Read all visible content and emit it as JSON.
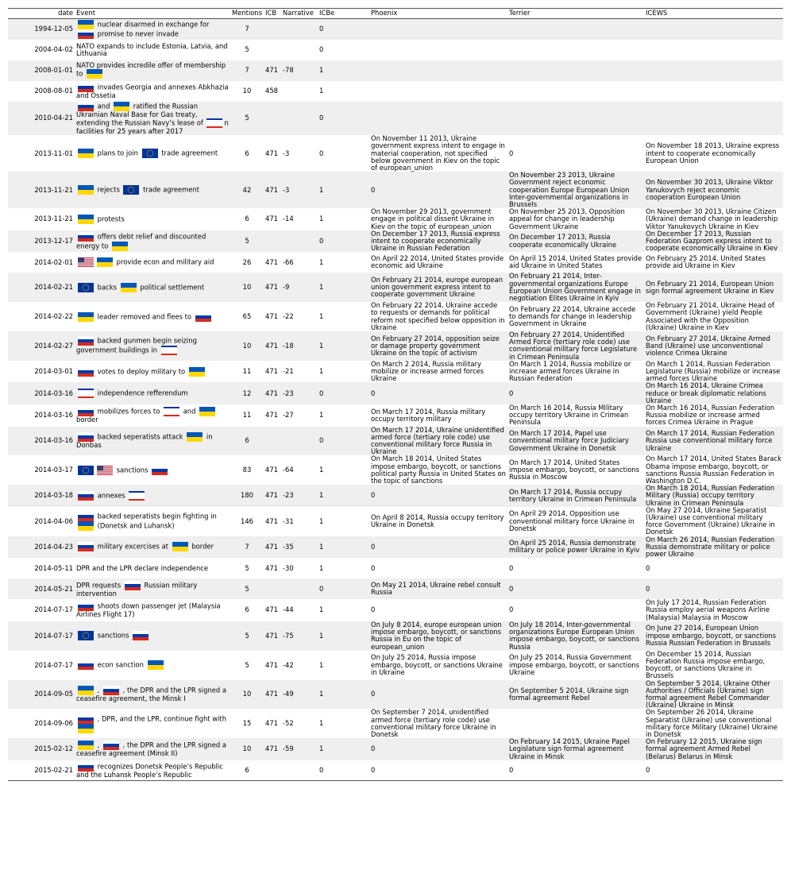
{
  "headers": {
    "date": "date",
    "event": "Event",
    "mentions": "Mentions",
    "icb": "ICB",
    "narrative": "Narrative",
    "icbe": "ICBe",
    "phoenix": "Phoenix",
    "terrier": "Terrier",
    "icews": "ICEWS"
  },
  "flags": {
    "ua": {
      "top": "#0057b7",
      "bottom": "#ffd700"
    },
    "ru": {
      "top": "#ffffff",
      "mid": "#0039a6",
      "bottom": "#d52b1e"
    },
    "eu": {
      "bg": "#003399",
      "stars": "#ffcc00"
    },
    "us": {
      "stripe": "#b22234",
      "canton": "#3c3b6e"
    },
    "crimea": {
      "top": "#0033a0",
      "mid": "#ffffff",
      "bottom": "#da291c"
    }
  },
  "rows": [
    {
      "date": "1994-12-05",
      "event": [
        [
          "flag",
          "ua"
        ],
        [
          "text",
          " nuclear disarmed in exchange for "
        ],
        [
          "flag",
          "ru"
        ],
        [
          "text",
          " promise to never invade"
        ]
      ],
      "mentions": "7",
      "icb": "",
      "narrative": "",
      "icbe": "0",
      "phoenix": "",
      "terrier": "",
      "icews": ""
    },
    {
      "date": "2004-04-02",
      "event": [
        [
          "text",
          "NATO expands to include Estonia, Latvia, and Lithuania"
        ]
      ],
      "mentions": "5",
      "icb": "",
      "narrative": "",
      "icbe": "0",
      "phoenix": "",
      "terrier": "",
      "icews": ""
    },
    {
      "date": "2008-01-01",
      "event": [
        [
          "text",
          "NATO provides incredile offer of membership to "
        ],
        [
          "flag",
          "ua"
        ]
      ],
      "mentions": "7",
      "icb": "471",
      "narrative": "-78",
      "icbe": "1",
      "phoenix": "",
      "terrier": "",
      "icews": ""
    },
    {
      "date": "2008-08-01",
      "event": [
        [
          "flag",
          "ru"
        ],
        [
          "text",
          " invades Georgia and annexes Abkhazia and Ossetia"
        ]
      ],
      "mentions": "10",
      "icb": "458",
      "narrative": "",
      "icbe": "1",
      "phoenix": "",
      "terrier": "",
      "icews": ""
    },
    {
      "date": "2010-04-21",
      "event": [
        [
          "flag",
          "ru"
        ],
        [
          "text",
          " and "
        ],
        [
          "flag",
          "ua"
        ],
        [
          "text",
          " ratified the Russian Ukrainian Naval Base for Gas treaty, extending the Russian Navy’s lease of "
        ],
        [
          "flag",
          "crimea"
        ],
        [
          "text",
          "n facilities for 25 years after 2017"
        ]
      ],
      "mentions": "5",
      "icb": "",
      "narrative": "",
      "icbe": "0",
      "phoenix": "",
      "terrier": "",
      "icews": ""
    },
    {
      "date": "2013-11-01",
      "event": [
        [
          "flag",
          "ua"
        ],
        [
          "text",
          " plans to join "
        ],
        [
          "flag",
          "eu"
        ],
        [
          "text",
          " trade agreement"
        ]
      ],
      "mentions": "6",
      "icb": "471",
      "narrative": "-3",
      "icbe": "0",
      "phoenix": "On November 11 2013, Ukraine government express intent to engage in material cooperation, not specified below government in Kiev on the topic of european_union",
      "terrier": "0",
      "icews": "On November 18 2013, Ukraine express intent to cooperate economically European Union"
    },
    {
      "date": "2013-11-21",
      "event": [
        [
          "flag",
          "ua"
        ],
        [
          "text",
          " rejects "
        ],
        [
          "flag",
          "eu"
        ],
        [
          "text",
          " trade agreement"
        ]
      ],
      "mentions": "42",
      "icb": "471",
      "narrative": "-3",
      "icbe": "1",
      "phoenix": "0",
      "terrier": "On November 23 2013, Ukraine Government reject economic cooperation Europe European Union Inter-governmental organizations in Brussels",
      "icews": "On November 30 2013, Ukraine Viktor Yanukovych reject economic cooperation European Union"
    },
    {
      "date": "2013-11-21",
      "event": [
        [
          "flag",
          "ua"
        ],
        [
          "text",
          " protests"
        ]
      ],
      "mentions": "6",
      "icb": "471",
      "narrative": "-14",
      "icbe": "1",
      "phoenix": "On November 29 2013, government engage in political dissent Ukraine in Kiev on the topic of european_union",
      "terrier": "On November 25 2013, Opposition appeal for change in leadership Government Ukraine",
      "icews": "On November 30 2013, Ukraine Citizen (Ukraine) demand change in leadership Viktor Yanukovych Ukraine in Kiev"
    },
    {
      "date": "2013-12-17",
      "event": [
        [
          "flag",
          "ru"
        ],
        [
          "text",
          " offers debt relief and discounted energy to "
        ],
        [
          "flag",
          "ua"
        ]
      ],
      "mentions": "5",
      "icb": "",
      "narrative": "",
      "icbe": "0",
      "phoenix": "On December 17 2013, Russia express intent to cooperate economically Ukraine in Russian Federation",
      "terrier": "On December 17 2013, Russia cooperate economically Ukraine",
      "icews": "On December 17 2013, Russian Federation Gazprom express intent to cooperate economically Ukraine in Kiev"
    },
    {
      "date": "2014-02-01",
      "event": [
        [
          "flag",
          "us"
        ],
        [
          "flag",
          "ua"
        ],
        [
          "text",
          " provide econ and military aid"
        ]
      ],
      "mentions": "26",
      "icb": "471",
      "narrative": "-66",
      "icbe": "1",
      "phoenix": "On April 22 2014, United States provide economic aid Ukraine",
      "terrier": "On April 15 2014, United States provide aid Ukraine in United States",
      "icews": "On February 25 2014, United States provide aid Ukraine in Kiev"
    },
    {
      "date": "2014-02-21",
      "event": [
        [
          "flag",
          "eu"
        ],
        [
          "text",
          " backs "
        ],
        [
          "flag",
          "ua"
        ],
        [
          "text",
          " political settlement"
        ]
      ],
      "mentions": "10",
      "icb": "471",
      "narrative": "-9",
      "icbe": "1",
      "phoenix": "On February 21 2014, europe european union government express intent to cooperate government Ukraine",
      "terrier": "On February 21 2014, Inter-governmental organizations Europe European Union Government engage in negotiation Elites Ukraine in Kyiv",
      "icews": "On February 21 2014, European Union sign formal agreement Ukraine in Kiev"
    },
    {
      "date": "2014-02-22",
      "event": [
        [
          "flag",
          "ua"
        ],
        [
          "text",
          " leader removed and flees to "
        ],
        [
          "flag",
          "ru"
        ]
      ],
      "mentions": "65",
      "icb": "471",
      "narrative": "-22",
      "icbe": "1",
      "phoenix": "On February 22 2014, Ukraine accede to requests or demands for political reform not specified below opposition in Ukraine",
      "terrier": "On February 22 2014, Ukraine accede to demands for change in leadership Government in Ukraine",
      "icews": "On February 21 2014, Ukraine Head of Government (Ukraine) yield People Associated with the Opposition (Ukraine) Ukraine in Kiev"
    },
    {
      "date": "2014-02-27",
      "event": [
        [
          "flag",
          "ru"
        ],
        [
          "text",
          " backed gunmen begin seizing government buildings in "
        ],
        [
          "flag",
          "crimea"
        ]
      ],
      "mentions": "10",
      "icb": "471",
      "narrative": "-18",
      "icbe": "1",
      "phoenix": "On February 27 2014, opposition seize or damage property government Ukraine on the topic of activism",
      "terrier": "On February 27 2014, Unidentified Armed Force (tertiary role code) use conventional military force Legislature in Crimean Peninsula",
      "icews": "On February 27 2014, Ukraine Armed Band (Ukraine) use unconventional violence Crimea Ukraine"
    },
    {
      "date": "2014-03-01",
      "event": [
        [
          "flag",
          "ru"
        ],
        [
          "text",
          " votes to deploy military to "
        ],
        [
          "flag",
          "ua"
        ]
      ],
      "mentions": "11",
      "icb": "471",
      "narrative": "-21",
      "icbe": "1",
      "phoenix": "On March 2 2014, Russia military mobilize or increase armed forces Ukraine",
      "terrier": "On March 1 2014, Russia mobilize or increase armed forces Ukraine in Russian Federation",
      "icews": "On March 1 2014, Russian Federation Legislature (Russia) mobilize or increase armed forces Ukraine"
    },
    {
      "date": "2014-03-16",
      "event": [
        [
          "flag",
          "crimea"
        ],
        [
          "text",
          " independence refferendum"
        ]
      ],
      "mentions": "12",
      "icb": "471",
      "narrative": "-23",
      "icbe": "0",
      "phoenix": "0",
      "terrier": "0",
      "icews": "On March 16 2014, Ukraine Crimea reduce or break diplomatic relations Ukraine"
    },
    {
      "date": "2014-03-16",
      "event": [
        [
          "flag",
          "ru"
        ],
        [
          "text",
          " mobilizes forces to "
        ],
        [
          "flag",
          "crimea"
        ],
        [
          "text",
          " and "
        ],
        [
          "flag",
          "ua"
        ],
        [
          "text",
          " border"
        ]
      ],
      "mentions": "11",
      "icb": "471",
      "narrative": "-27",
      "icbe": "1",
      "phoenix": "On March 17 2014, Russia military occupy territory military",
      "terrier": "On March 16 2014, Russia MIlitary occupy territory Ukraine in Crimean Peninsula",
      "icews": "On March 16 2014, Russian Federation Russia mobilize or increase armed forces Crimea Ukraine in Prague"
    },
    {
      "date": "2014-03-16",
      "event": [
        [
          "flag",
          "ru"
        ],
        [
          "text",
          " backed seperatists attack "
        ],
        [
          "flag",
          "ua"
        ],
        [
          "text",
          " in Donbas"
        ]
      ],
      "mentions": "6",
      "icb": "",
      "narrative": "",
      "icbe": "0",
      "phoenix": "On March 17 2014, Ukraine unidentified armed force (tertiary role code) use conventional military force Russia in Ukraine",
      "terrier": "On March 17 2014, Papel use conventional military force Judiciary Government Ukraine in Donetsk",
      "icews": "On March 17 2014, Russian Federation Russia use conventional military force Ukraine"
    },
    {
      "date": "2014-03-17",
      "event": [
        [
          "flag",
          "eu"
        ],
        [
          "flag",
          "us"
        ],
        [
          "text",
          " sanctions "
        ],
        [
          "flag",
          "ru"
        ]
      ],
      "mentions": "83",
      "icb": "471",
      "narrative": "-64",
      "icbe": "1",
      "phoenix": "On March 18 2014, United States impose embargo, boycott, or sanctions political party Russia in United States on the topic of sanctions",
      "terrier": "On March 17 2014, United States impose embargo, boycott, or sanctions Russia in Moscow",
      "icews": "On March 17 2014, United States Barack Obama impose embargo, boycott, or sanctions Russia Russian Federation in Washington D.C."
    },
    {
      "date": "2014-03-18",
      "event": [
        [
          "flag",
          "ru"
        ],
        [
          "text",
          " annexes "
        ],
        [
          "flag",
          "crimea"
        ]
      ],
      "mentions": "180",
      "icb": "471",
      "narrative": "-23",
      "icbe": "1",
      "phoenix": "0",
      "terrier": "On March 17 2014, Russia occupy territory Ukraine in Crimean Peninsula",
      "icews": "On March 18 2014, Russian Federation Military (Russia) occupy territory Ukraine in Crimean Peninsula"
    },
    {
      "date": "2014-04-06",
      "event": [
        [
          "flag",
          "ru"
        ],
        [
          "text",
          " backed seperatists begin fighting in "
        ],
        [
          "flag",
          "ua"
        ],
        [
          "text",
          " (Donetsk and Luhansk)"
        ]
      ],
      "mentions": "146",
      "icb": "471",
      "narrative": "-31",
      "icbe": "1",
      "phoenix": "On April 8 2014, Russia occupy territory Ukraine in Donetsk",
      "terrier": "On April 29 2014, Opposition use conventional military force Ukraine in Donetsk",
      "icews": "On May 27 2014, Ukraine Separatist (Ukraine) use conventional military force Government (Ukraine) Ukraine in Donetsk"
    },
    {
      "date": "2014-04-23",
      "event": [
        [
          "flag",
          "ru"
        ],
        [
          "text",
          " military excercises at "
        ],
        [
          "flag",
          "ua"
        ],
        [
          "text",
          " border"
        ]
      ],
      "mentions": "7",
      "icb": "471",
      "narrative": "-35",
      "icbe": "1",
      "phoenix": "0",
      "terrier": "On April 25 2014, Russia demonstrate military or police power Ukraine in Kyiv",
      "icews": "On March 26 2014, Russian Federation Russia demonstrate military or police power Ukraine"
    },
    {
      "date": "2014-05-11",
      "event": [
        [
          "text",
          "DPR and the LPR declare independence"
        ]
      ],
      "mentions": "5",
      "icb": "471",
      "narrative": "-30",
      "icbe": "1",
      "phoenix": "0",
      "terrier": "0",
      "icews": "0"
    },
    {
      "date": "2014-05-21",
      "event": [
        [
          "text",
          "DPR requests "
        ],
        [
          "flag",
          "ru"
        ],
        [
          "text",
          " Russian military intervention"
        ]
      ],
      "mentions": "5",
      "icb": "",
      "narrative": "",
      "icbe": "0",
      "phoenix": "On May 21 2014, Ukraine rebel consult Russia",
      "terrier": "0",
      "icews": "0"
    },
    {
      "date": "2014-07-17",
      "event": [
        [
          "flag",
          "ru"
        ],
        [
          "text",
          " shoots down passenger jet (Malaysia Airlines Flight 17)"
        ]
      ],
      "mentions": "6",
      "icb": "471",
      "narrative": "-44",
      "icbe": "1",
      "phoenix": "0",
      "terrier": "0",
      "icews": "On July 17 2014, Russian Federation Russia employ aerial weapons Airline (Malaysia) Malaysia in Moscow"
    },
    {
      "date": "2014-07-17",
      "event": [
        [
          "flag",
          "eu"
        ],
        [
          "text",
          " sanctions "
        ],
        [
          "flag",
          "ru"
        ]
      ],
      "mentions": "5",
      "icb": "471",
      "narrative": "-75",
      "icbe": "1",
      "phoenix": "On July 8 2014, europe european union impose embargo, boycott, or sanctions Russia in Eu on the topic of european_union",
      "terrier": "On July 18 2014, Inter-governmental organizations Europe European Union impose embargo, boycott, or sanctions Russia",
      "icews": "On June 27 2014, European Union impose embargo, boycott, or sanctions Russia Russian Federation in Brussels"
    },
    {
      "date": "2014-07-17",
      "event": [
        [
          "flag",
          "ru"
        ],
        [
          "text",
          " econ sanction "
        ],
        [
          "flag",
          "ua"
        ]
      ],
      "mentions": "5",
      "icb": "471",
      "narrative": "-42",
      "icbe": "1",
      "phoenix": "On July 25 2014, Russia impose embargo, boycott, or sanctions Ukraine in Ukraine",
      "terrier": "On July 25 2014, Russia Government impose embargo, boycott, or sanctions Ukraine",
      "icews": "On December 15 2014, Russian Federation Russia impose embargo, boycott, or sanctions Ukraine in Brussels"
    },
    {
      "date": "2014-09-05",
      "event": [
        [
          "flag",
          "ua"
        ],
        [
          "text",
          " , "
        ],
        [
          "flag",
          "ru"
        ],
        [
          "text",
          " , the DPR and the LPR signed a ceasefire agreement, the Minsk I"
        ]
      ],
      "mentions": "10",
      "icb": "471",
      "narrative": "-49",
      "icbe": "1",
      "phoenix": "0",
      "terrier": "On September 5 2014, Ukraine sign formal agreement Rebel",
      "icews": "On September 5 2014, Ukraine Other Authorities / Officials (Ukraine) sign formal agreement Rebel Commander (Ukraine) Ukraine in Minsk"
    },
    {
      "date": "2014-09-06",
      "event": [
        [
          "flag",
          "ru"
        ],
        [
          "text",
          " , DPR, and the LPR, continue fight with "
        ],
        [
          "flag",
          "ua"
        ]
      ],
      "mentions": "15",
      "icb": "471",
      "narrative": "-52",
      "icbe": "1",
      "phoenix": "On September 7 2014, unidentified armed force (tertiary role code) use conventional military force Ukraine in Donetsk",
      "terrier": "",
      "icews": "On September 26 2014, Ukraine Separatist (Ukraine) use conventional military force Military (Ukraine) Ukraine in Donetsk"
    },
    {
      "date": "2015-02-12",
      "event": [
        [
          "flag",
          "ua"
        ],
        [
          "text",
          " , "
        ],
        [
          "flag",
          "ru"
        ],
        [
          "text",
          " , the DPR and the LPR signed a ceasefire agreement (Minsk II)"
        ]
      ],
      "mentions": "10",
      "icb": "471",
      "narrative": "-59",
      "icbe": "1",
      "phoenix": "0",
      "terrier": "On February 14 2015, Ukraine Papel Legislature sign formal agreement Ukraine in Minsk",
      "icews": "On February 12 2015, Ukraine sign formal agreement Armed Rebel (Belarus) Belarus in Minsk"
    },
    {
      "date": "2015-02-21",
      "event": [
        [
          "flag",
          "ru"
        ],
        [
          "text",
          " recognizes Donetsk People’s Republic and the Luhansk People’s Republic"
        ]
      ],
      "mentions": "6",
      "icb": "",
      "narrative": "",
      "icbe": "0",
      "phoenix": "0",
      "terrier": "0",
      "icews": "0"
    }
  ]
}
